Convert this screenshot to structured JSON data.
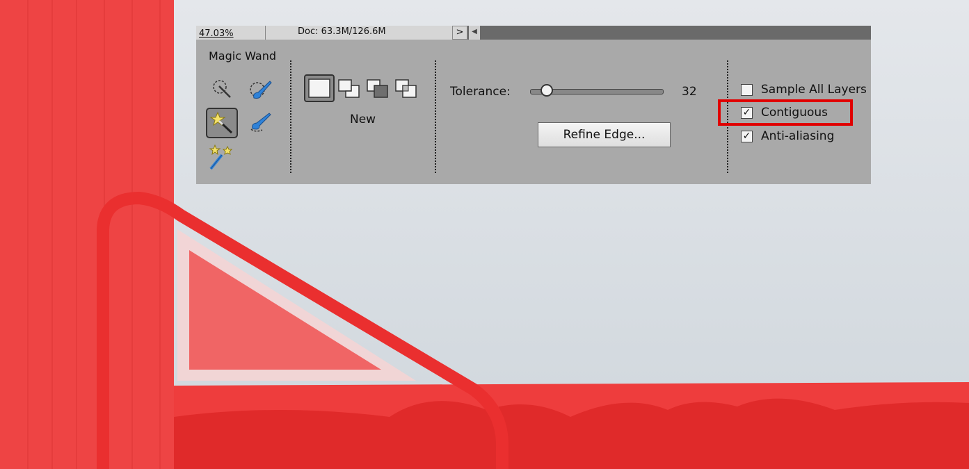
{
  "status_bar": {
    "zoom": "47.03%",
    "doc_size": "Doc: 63.3M/126.6M",
    "expand_arrow": ">",
    "scroll_left_arrow": "◀"
  },
  "options_bar": {
    "tool_name": "Magic Wand",
    "tools": [
      "quick-selection-tool",
      "quick-selection-brush-tool",
      "magic-wand-tool",
      "refine-selection-brush-tool",
      "auto-selection-tool"
    ],
    "active_tool": "magic-wand-tool",
    "selection_modes": [
      "new",
      "add",
      "subtract",
      "intersect"
    ],
    "active_mode_label": "New",
    "tolerance_label": "Tolerance:",
    "tolerance_value": "32",
    "tolerance_level": 0.125,
    "refine_edge_label": "Refine Edge...",
    "checkboxes": [
      {
        "label": "Sample All Layers",
        "checked": false
      },
      {
        "label": "Contiguous",
        "checked": true
      },
      {
        "label": "Anti-aliasing",
        "checked": true
      }
    ],
    "check_mark": "✓"
  },
  "colors": {
    "selection_overlay": "#f04545",
    "highlight_box": "#e00000",
    "sky": "#dfe3e8"
  }
}
